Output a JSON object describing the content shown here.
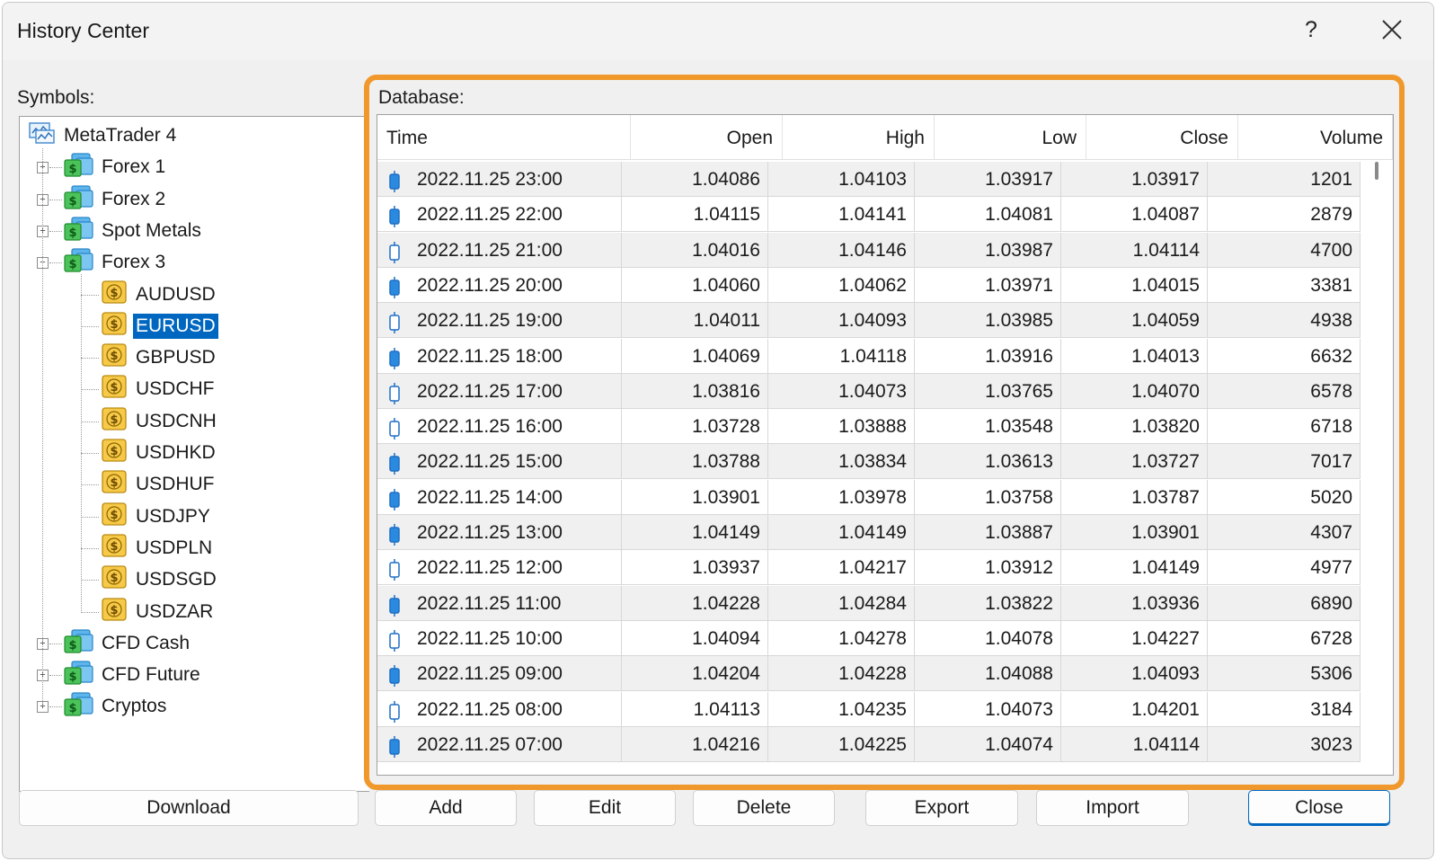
{
  "window": {
    "title": "History Center",
    "help_label": "?"
  },
  "symbols": {
    "label": "Symbols:",
    "root": "MetaTrader 4",
    "groups_top": [
      "Forex 1",
      "Forex 2",
      "Spot Metals"
    ],
    "expanded_group": "Forex 3",
    "children": [
      "AUDUSD",
      "EURUSD",
      "GBPUSD",
      "USDCHF",
      "USDCNH",
      "USDHKD",
      "USDHUF",
      "USDJPY",
      "USDPLN",
      "USDSGD",
      "USDZAR"
    ],
    "selected": "EURUSD",
    "groups_bottom": [
      "CFD Cash",
      "CFD Future",
      "Cryptos"
    ],
    "currency_glyph": "$"
  },
  "database": {
    "label": "Database:",
    "columns": [
      "Time",
      "Open",
      "High",
      "Low",
      "Close",
      "Volume"
    ],
    "rows": [
      {
        "time": "2022.11.25 23:00",
        "open": "1.04086",
        "high": "1.04103",
        "low": "1.03917",
        "close": "1.03917",
        "volume": "1201",
        "bear": true
      },
      {
        "time": "2022.11.25 22:00",
        "open": "1.04115",
        "high": "1.04141",
        "low": "1.04081",
        "close": "1.04087",
        "volume": "2879",
        "bear": true
      },
      {
        "time": "2022.11.25 21:00",
        "open": "1.04016",
        "high": "1.04146",
        "low": "1.03987",
        "close": "1.04114",
        "volume": "4700",
        "bear": false
      },
      {
        "time": "2022.11.25 20:00",
        "open": "1.04060",
        "high": "1.04062",
        "low": "1.03971",
        "close": "1.04015",
        "volume": "3381",
        "bear": true
      },
      {
        "time": "2022.11.25 19:00",
        "open": "1.04011",
        "high": "1.04093",
        "low": "1.03985",
        "close": "1.04059",
        "volume": "4938",
        "bear": false
      },
      {
        "time": "2022.11.25 18:00",
        "open": "1.04069",
        "high": "1.04118",
        "low": "1.03916",
        "close": "1.04013",
        "volume": "6632",
        "bear": true
      },
      {
        "time": "2022.11.25 17:00",
        "open": "1.03816",
        "high": "1.04073",
        "low": "1.03765",
        "close": "1.04070",
        "volume": "6578",
        "bear": false
      },
      {
        "time": "2022.11.25 16:00",
        "open": "1.03728",
        "high": "1.03888",
        "low": "1.03548",
        "close": "1.03820",
        "volume": "6718",
        "bear": false
      },
      {
        "time": "2022.11.25 15:00",
        "open": "1.03788",
        "high": "1.03834",
        "low": "1.03613",
        "close": "1.03727",
        "volume": "7017",
        "bear": true
      },
      {
        "time": "2022.11.25 14:00",
        "open": "1.03901",
        "high": "1.03978",
        "low": "1.03758",
        "close": "1.03787",
        "volume": "5020",
        "bear": true
      },
      {
        "time": "2022.11.25 13:00",
        "open": "1.04149",
        "high": "1.04149",
        "low": "1.03887",
        "close": "1.03901",
        "volume": "4307",
        "bear": true
      },
      {
        "time": "2022.11.25 12:00",
        "open": "1.03937",
        "high": "1.04217",
        "low": "1.03912",
        "close": "1.04149",
        "volume": "4977",
        "bear": false
      },
      {
        "time": "2022.11.25 11:00",
        "open": "1.04228",
        "high": "1.04284",
        "low": "1.03822",
        "close": "1.03936",
        "volume": "6890",
        "bear": true
      },
      {
        "time": "2022.11.25 10:00",
        "open": "1.04094",
        "high": "1.04278",
        "low": "1.04078",
        "close": "1.04227",
        "volume": "6728",
        "bear": false
      },
      {
        "time": "2022.11.25 09:00",
        "open": "1.04204",
        "high": "1.04228",
        "low": "1.04088",
        "close": "1.04093",
        "volume": "5306",
        "bear": true
      },
      {
        "time": "2022.11.25 08:00",
        "open": "1.04113",
        "high": "1.04235",
        "low": "1.04073",
        "close": "1.04201",
        "volume": "3184",
        "bear": false
      },
      {
        "time": "2022.11.25 07:00",
        "open": "1.04216",
        "high": "1.04225",
        "low": "1.04074",
        "close": "1.04114",
        "volume": "3023",
        "bear": true
      }
    ]
  },
  "buttons": {
    "download": "Download",
    "add": "Add",
    "edit": "Edit",
    "delete": "Delete",
    "export": "Export",
    "import": "Import",
    "close": "Close"
  },
  "colors": {
    "highlight_frame": "#f0982c",
    "selection": "#0067c0",
    "candle_fill": "#2a8ae0",
    "candle_outline": "#1e6fc4"
  },
  "icons": {
    "root": "terminal-chart-icon",
    "group": "folder-currency-icon",
    "symbol": "currency-symbol-icon",
    "row": "candlestick-icon"
  }
}
